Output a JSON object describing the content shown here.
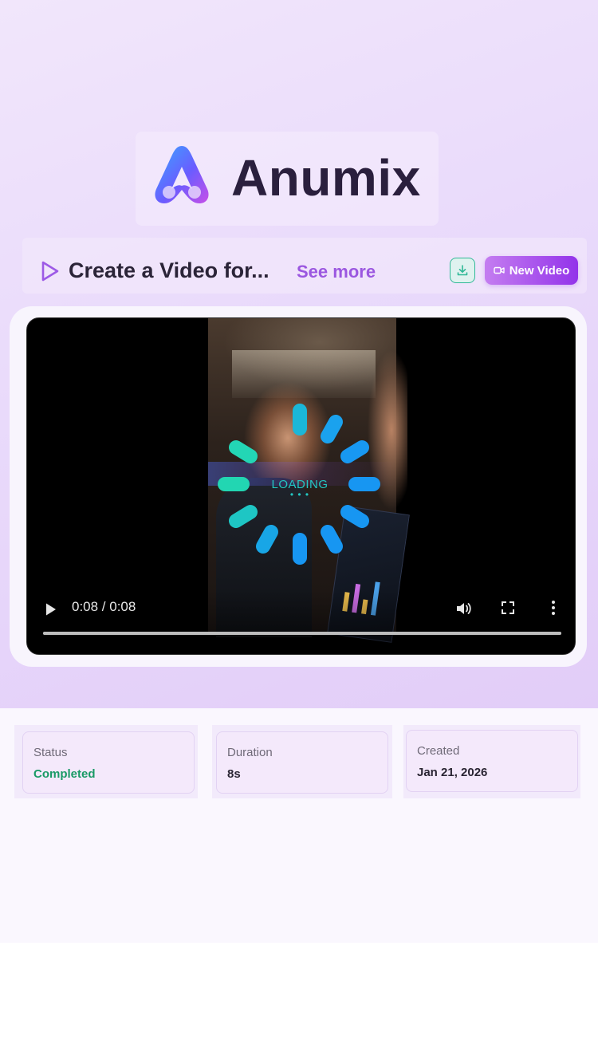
{
  "brand": {
    "name": "Anumix",
    "logo_icon": "anumix-logo-icon"
  },
  "header": {
    "video_title": "Create a Video for...",
    "see_more_label": "See more",
    "download_icon": "download-icon",
    "new_video_label": "New Video",
    "new_video_icon": "video-camera-icon"
  },
  "player": {
    "loading_text": "LOADING",
    "loading_dots": "• • •",
    "time_display": "0:08 / 0:08",
    "progress_fraction": 1.0,
    "icons": [
      "play-icon",
      "volume-icon",
      "fullscreen-icon",
      "more-options-icon"
    ]
  },
  "info": {
    "status": {
      "label": "Status",
      "value": "Completed"
    },
    "duration": {
      "label": "Duration",
      "value": "8s"
    },
    "created": {
      "label": "Created",
      "value": "Jan 21, 2026"
    }
  },
  "colors": {
    "accent_purple": "#9333ea",
    "see_more": "#9b57e0",
    "status_completed": "#1a9a66",
    "spinner_teal": "#23d6b5",
    "spinner_blue": "#1796f2"
  }
}
